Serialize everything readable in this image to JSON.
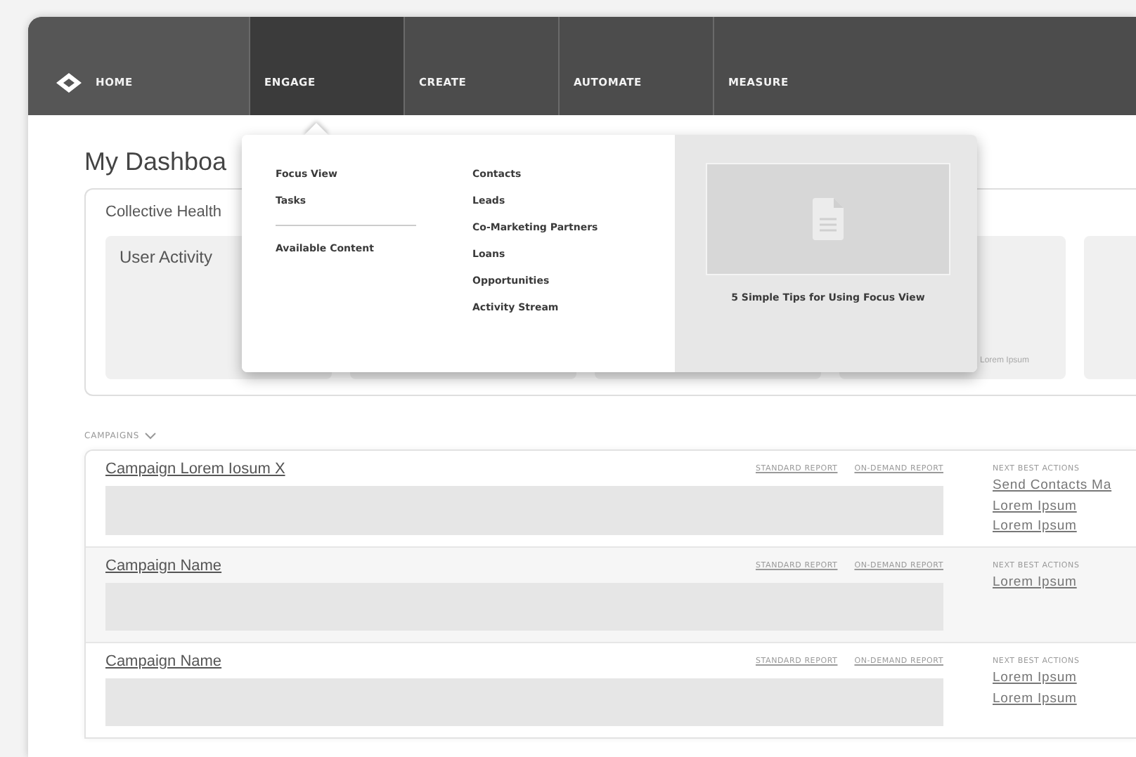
{
  "nav": {
    "items": [
      {
        "label": "HOME",
        "kind": "home",
        "selected": false
      },
      {
        "label": "ENGAGE",
        "kind": "section",
        "selected": true
      },
      {
        "label": "CREATE",
        "kind": "section",
        "selected": false
      },
      {
        "label": "AUTOMATE",
        "kind": "section",
        "selected": false
      },
      {
        "label": "MEASURE",
        "kind": "section",
        "selected": false
      }
    ]
  },
  "menu": {
    "left_items": [
      "Focus View",
      "Tasks"
    ],
    "left_more": [
      "Available Content"
    ],
    "right_items": [
      "Contacts",
      "Leads",
      "Co-Marketing Partners",
      "Loans",
      "Opportunities",
      "Activity Stream"
    ],
    "feature": {
      "caption": "5 Simple Tips for Using Focus View"
    }
  },
  "page_title": "My Dashboa",
  "collective_health": {
    "title": "Collective Health",
    "tiles": [
      {
        "kind": "titled",
        "text": "User Activity"
      },
      {
        "kind": "blank"
      },
      {
        "kind": "blank"
      },
      {
        "kind": "footer",
        "text": "Lorem Ipsum"
      },
      {
        "kind": "blank"
      }
    ]
  },
  "campaigns": {
    "label": "CAMPAIGNS",
    "expanded": true,
    "rows": [
      {
        "name": "Campaign Lorem Iosum X",
        "reports": [
          "STANDARD REPORT",
          "ON-DEMAND REPORT"
        ],
        "actions_label": "NEXT BEST ACTIONS",
        "actions": [
          "Send Contacts Ma",
          "Lorem Ipsum",
          "Lorem Ipsum"
        ]
      },
      {
        "name": "Campaign Name",
        "reports": [
          "STANDARD REPORT",
          "ON-DEMAND REPORT"
        ],
        "actions_label": "NEXT BEST ACTIONS",
        "actions": [
          "Lorem Ipsum"
        ]
      },
      {
        "name": "Campaign Name",
        "reports": [
          "STANDARD REPORT",
          "ON-DEMAND REPORT"
        ],
        "actions_label": "NEXT BEST ACTIONS",
        "actions": [
          "Lorem Ipsum",
          "Lorem Ipsum"
        ]
      }
    ]
  }
}
